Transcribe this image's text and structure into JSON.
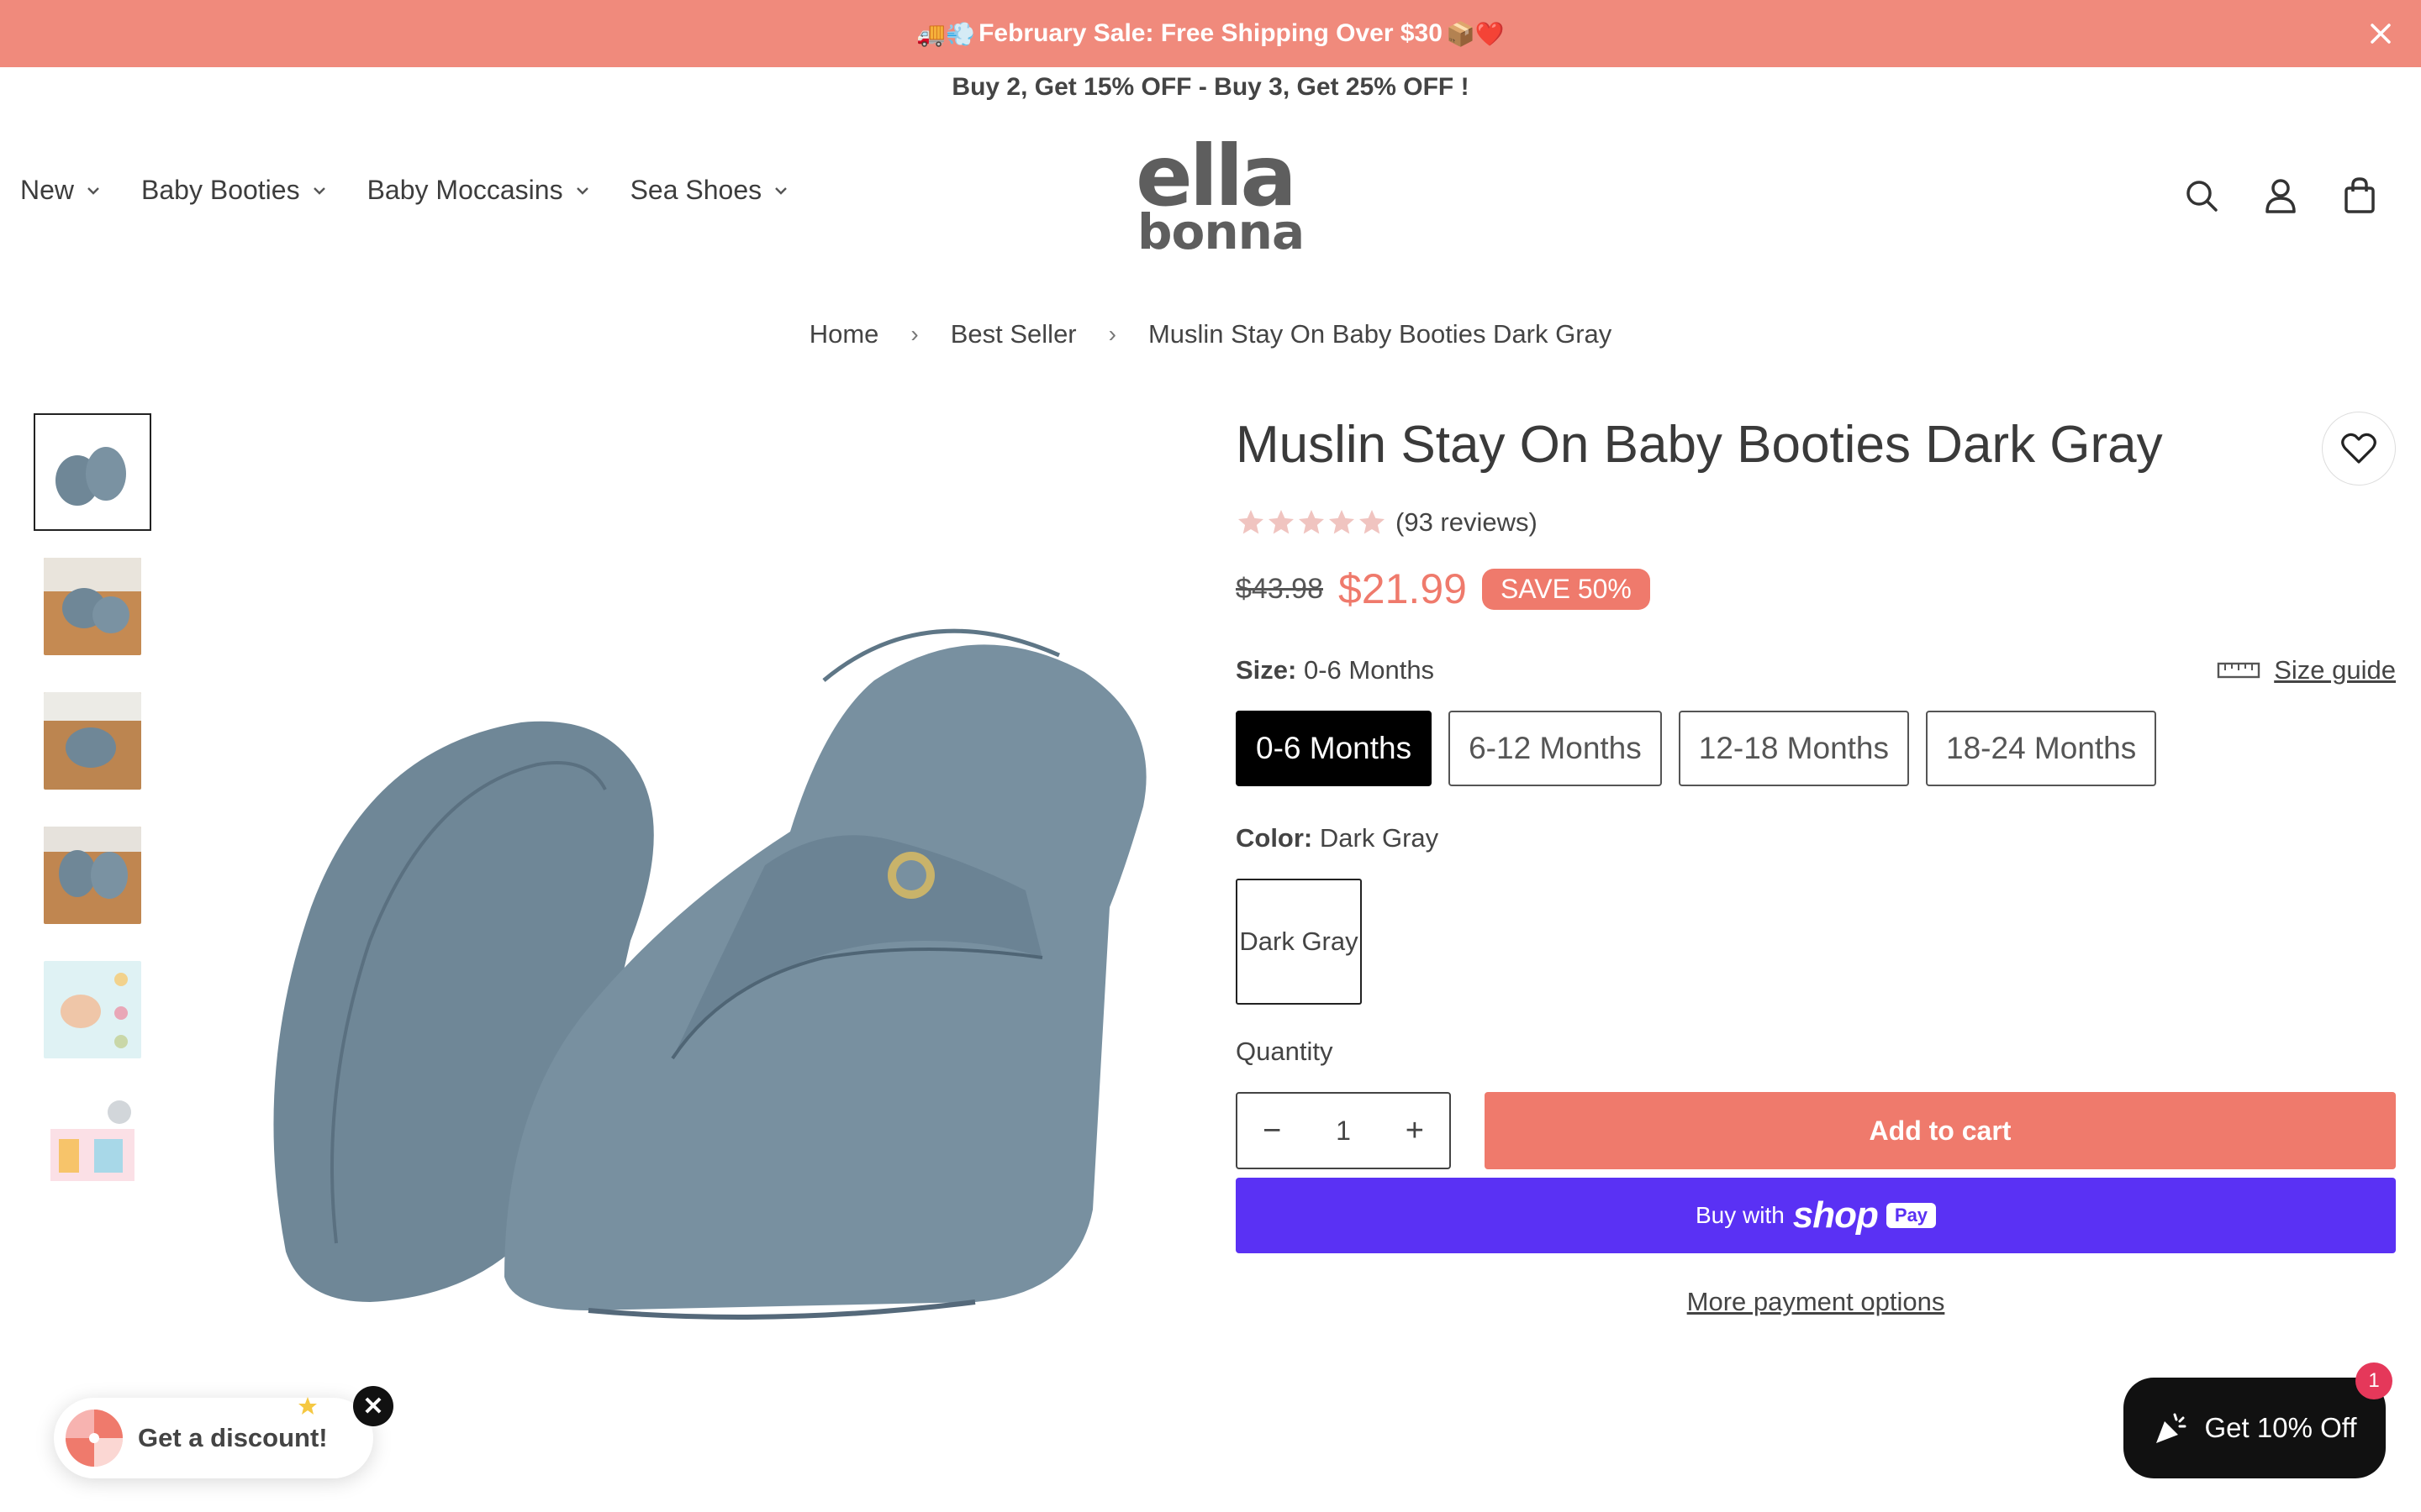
{
  "announcement": {
    "emoji_left": "🚚💨",
    "text": "February Sale: Free Shipping Over $30",
    "emoji_right": "📦❤️"
  },
  "promo": "Buy 2, Get 15% OFF - Buy 3, Get 25% OFF !",
  "nav": {
    "items": [
      {
        "label": "New"
      },
      {
        "label": "Baby Booties"
      },
      {
        "label": "Baby Moccasins"
      },
      {
        "label": "Sea Shoes"
      }
    ]
  },
  "logo": {
    "line1": "ella",
    "line2": "bonna"
  },
  "breadcrumb": [
    "Home",
    "Best Seller",
    "Muslin Stay On Baby Booties Dark Gray"
  ],
  "product": {
    "title": "Muslin Stay On Baby Booties Dark Gray",
    "rating": 5,
    "reviews": "(93 reviews)",
    "compare_price": "$43.98",
    "price": "$21.99",
    "save_badge": "SAVE 50%",
    "size_label": "Size:",
    "size_value": "0-6 Months",
    "size_guide": "Size guide",
    "sizes": [
      "0-6 Months",
      "6-12 Months",
      "12-18 Months",
      "18-24 Months"
    ],
    "selected_size_index": 0,
    "color_label": "Color:",
    "color_value": "Dark Gray",
    "color_swatch": "Dark Gray",
    "quantity_label": "Quantity",
    "quantity": "1",
    "add_to_cart": "Add to cart",
    "shoppay_prefix": "Buy with",
    "shoppay_brand": "shop",
    "shoppay_pay": "Pay",
    "more_payment": "More payment options"
  },
  "widgets": {
    "discount": "Get a discount!",
    "close": "✕",
    "ten_off": "Get 10% Off",
    "ten_off_badge": "1"
  },
  "colors": {
    "accent": "#ef7a6c",
    "announce_bg": "#f08a7c",
    "shoppay": "#5a31f4",
    "bootie": "#6f8797",
    "star": "#f0c4c0"
  }
}
